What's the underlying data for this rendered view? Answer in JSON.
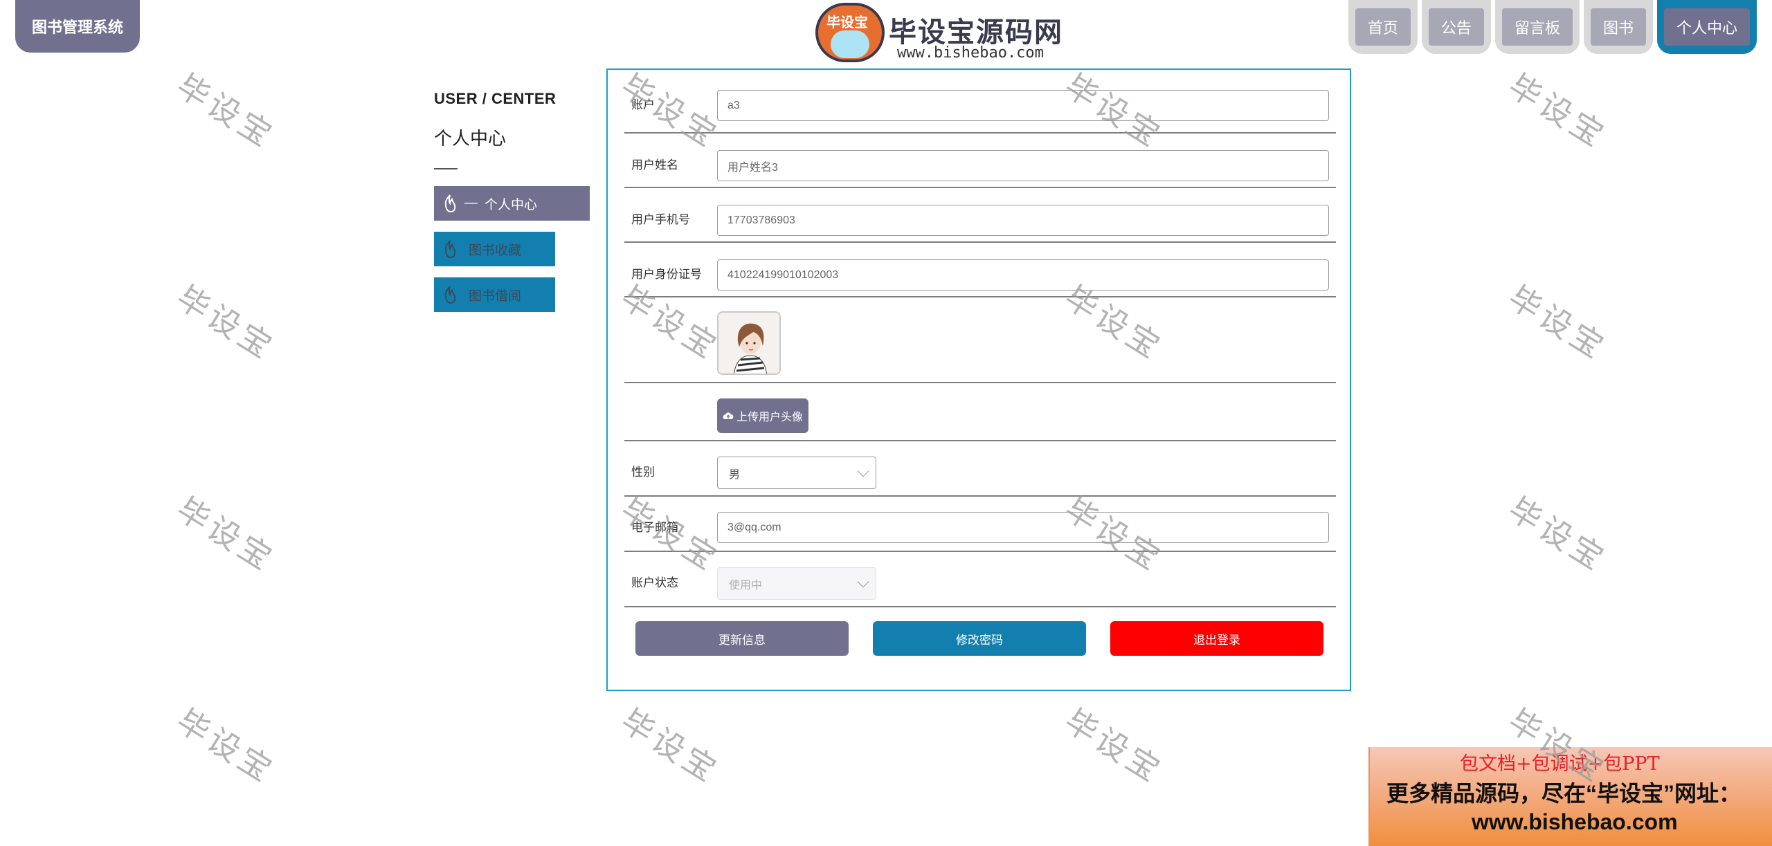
{
  "header": {
    "brand": "图书管理系统",
    "logo_badge": "毕设宝",
    "logo_title": "毕设宝源码网",
    "logo_url": "www.bishebao.com"
  },
  "nav": [
    {
      "label": "首页",
      "active": false
    },
    {
      "label": "公告",
      "active": false
    },
    {
      "label": "留言板",
      "active": false
    },
    {
      "label": "图书",
      "active": false
    },
    {
      "label": "个人中心",
      "active": true
    }
  ],
  "side": {
    "title_en": "USER / CENTER",
    "title_cn": "个人中心",
    "items": [
      {
        "label": "个人中心",
        "prefix": "—",
        "active": true
      },
      {
        "label": "图书收藏",
        "active": false
      },
      {
        "label": "图书借阅",
        "active": false
      }
    ]
  },
  "form": {
    "account": {
      "label": "账户",
      "value": "a3"
    },
    "name": {
      "label": "用户姓名",
      "value": "用户姓名3"
    },
    "phone": {
      "label": "用户手机号",
      "value": "17703786903"
    },
    "idcard": {
      "label": "用户身份证号",
      "value": "410224199010102003"
    },
    "upload_label": "上传用户头像",
    "gender": {
      "label": "性别",
      "value": "男"
    },
    "email": {
      "label": "电子邮箱",
      "value": "3@qq.com"
    },
    "status": {
      "label": "账户状态",
      "value": "使用中"
    }
  },
  "buttons": {
    "update": "更新信息",
    "password": "修改密码",
    "logout": "退出登录"
  },
  "colors": {
    "primary": "#71708f",
    "accent": "#137faf",
    "danger": "#ff0000",
    "panel_border": "#17a2c9"
  },
  "watermark": "毕设宝",
  "promo": {
    "line1": "包文档+包调试+包PPT",
    "line2": "更多精品源码，尽在“毕设宝”网址：",
    "line3": "www.bishebao.com"
  }
}
